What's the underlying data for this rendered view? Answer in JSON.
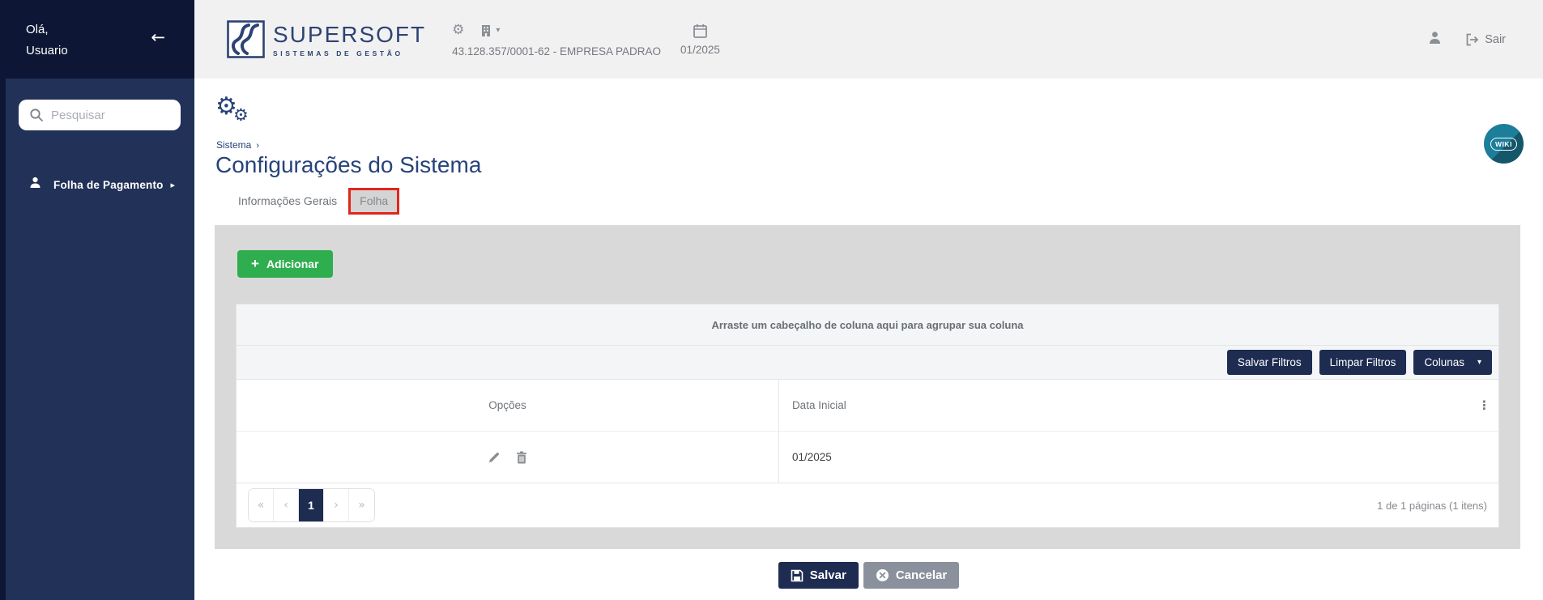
{
  "sidebar": {
    "greeting_line1": "Olá,",
    "greeting_line2": "Usuario",
    "collapse_icon": "←",
    "search_placeholder": "Pesquisar",
    "menu_item": "Folha de Pagamento",
    "menu_caret": "▸"
  },
  "header": {
    "logo_title": "SUPERSOFT",
    "logo_subtitle": "SISTEMAS DE GESTÃO",
    "gear_icon": "⚙",
    "dropdown_caret": "▾",
    "company": "43.128.357/0001-62 - EMPRESA PADRAO",
    "period": "01/2025",
    "logout_label": "Sair"
  },
  "page": {
    "breadcrumb": "Sistema",
    "breadcrumb_sep": "›",
    "gear_icon": "⚙",
    "title": "Configurações do Sistema",
    "wiki_label": "WIKI",
    "tabs": [
      {
        "label": "Informações Gerais"
      },
      {
        "label": "Folha"
      }
    ]
  },
  "panel": {
    "add_label": "Adicionar",
    "add_plus": "+",
    "grid": {
      "group_hint": "Arraste um cabeçalho de coluna aqui para agrupar sua coluna",
      "toolbar": {
        "save_filters": "Salvar Filtros",
        "clear_filters": "Limpar Filtros",
        "columns": "Colunas",
        "columns_caret": "▾"
      },
      "columns": [
        "Opções",
        "Data Inicial"
      ],
      "column_menu_icon": "⋮",
      "rows": [
        {
          "data_inicial": "01/2025"
        }
      ],
      "pagination": {
        "first": "«",
        "prev": "‹",
        "current": "1",
        "next": "›",
        "last": "»",
        "info": "1 de 1 páginas (1 itens)"
      }
    }
  },
  "footer": {
    "save_label": "Salvar",
    "cancel_label": "Cancelar"
  },
  "colors": {
    "sidebar_dark": "#0d1634",
    "sidebar_body": "#223158",
    "brand_navy": "#2d4373",
    "title_navy": "#27437a",
    "button_navy": "#1e2c52",
    "success_green": "#2fae4f",
    "highlight_red": "#e1251b",
    "wiki_teal": "#1c7e9b",
    "panel_gray": "#d9d9d9",
    "header_gray": "#f1f1f2"
  }
}
